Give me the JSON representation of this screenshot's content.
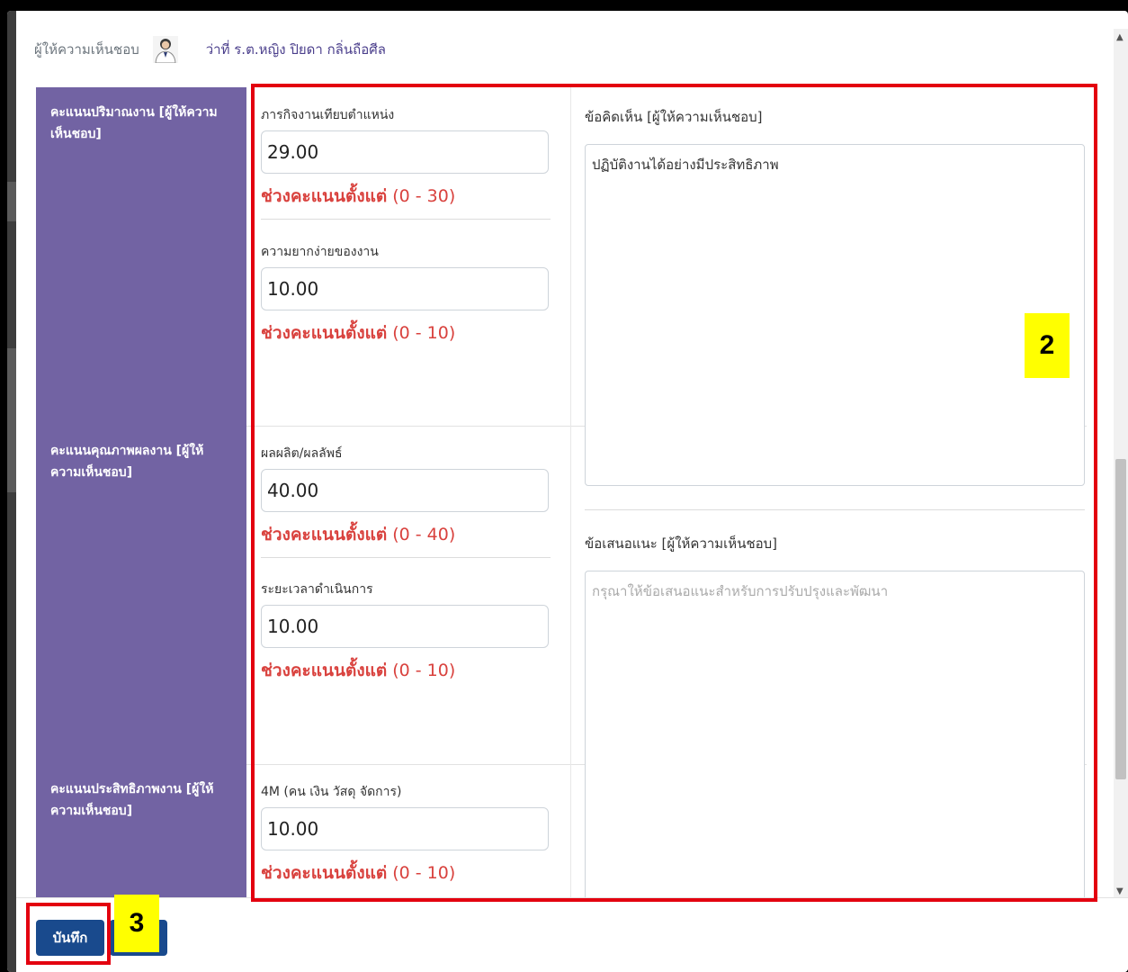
{
  "reviewer": {
    "label": "ผู้ให้ความเห็นชอบ",
    "name": "ว่าที่ ร.ต.หญิง ปิยดา กลิ่นถือศีล"
  },
  "sections": [
    {
      "category": "คะแนนปริมาณงาน [ผู้ให้ความเห็นชอบ]",
      "fields": [
        {
          "label": "ภารกิจงานเทียบตำแหน่ง",
          "value": "29.00",
          "range_prefix": "ช่วงคะแนนตั้งแต่",
          "range": " (0 - 30)"
        },
        {
          "label": "ความยากง่ายของงาน",
          "value": "10.00",
          "range_prefix": "ช่วงคะแนนตั้งแต่",
          "range": " (0 - 10)"
        }
      ]
    },
    {
      "category": "คะแนนคุณภาพผลงาน [ผู้ให้ความเห็นชอบ]",
      "fields": [
        {
          "label": "ผลผลิต/ผลลัพธ์",
          "value": "40.00",
          "range_prefix": "ช่วงคะแนนตั้งแต่",
          "range": " (0 - 40)"
        },
        {
          "label": "ระยะเวลาดำเนินการ",
          "value": "10.00",
          "range_prefix": "ช่วงคะแนนตั้งแต่",
          "range": " (0 - 10)"
        }
      ]
    },
    {
      "category": "คะแนนประสิทธิภาพงาน [ผู้ให้ความเห็นชอบ]",
      "fields": [
        {
          "label": "4M (คน เงิน วัสดุ จัดการ)",
          "value": "10.00",
          "range_prefix": "ช่วงคะแนนตั้งแต่",
          "range": " (0 - 10)"
        }
      ]
    }
  ],
  "comment": {
    "label": "ข้อคิดเห็น [ผู้ให้ความเห็นชอบ]",
    "value": "ปฏิบัติงานได้อย่างมีประสิทธิภาพ"
  },
  "suggestion": {
    "label": "ข้อเสนอแนะ [ผู้ให้ความเห็นชอบ]",
    "placeholder": "กรุณาให้ข้อเสนอแนะสำหรับการปรับปรุงและพัฒนา"
  },
  "footer": {
    "save_label": "บันทึก"
  },
  "annotations": {
    "callout_2": "2",
    "callout_3": "3",
    "color": "#e3000f",
    "badge_color": "#ffff00"
  },
  "colors": {
    "category_bg": "#7263a3",
    "range_text": "#d9423e",
    "primary_button": "#194a8d"
  }
}
